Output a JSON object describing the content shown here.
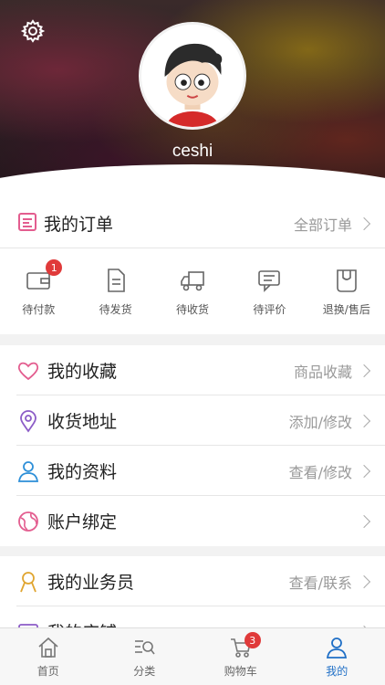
{
  "profile": {
    "username": "ceshi"
  },
  "orders": {
    "title": "我的订单",
    "all_label": "全部订单",
    "items": [
      {
        "label": "待付款",
        "badge": "1"
      },
      {
        "label": "待发货"
      },
      {
        "label": "待收货"
      },
      {
        "label": "待评价"
      },
      {
        "label": "退换/售后"
      }
    ]
  },
  "menu": [
    {
      "label": "我的收藏",
      "action": "商品收藏",
      "icon": "heart-icon",
      "color": "#e35d8f"
    },
    {
      "label": "收货地址",
      "action": "添加/修改",
      "icon": "location-pin-icon",
      "color": "#8c5cc7"
    },
    {
      "label": "我的资料",
      "action": "查看/修改",
      "icon": "user-icon",
      "color": "#2d8fd8"
    },
    {
      "label": "账户绑定",
      "action": "",
      "icon": "globe-icon",
      "color": "#e35d8f"
    }
  ],
  "menu2": [
    {
      "label": "我的业务员",
      "action": "查看/联系",
      "icon": "agent-icon",
      "color": "#e0a530"
    },
    {
      "label": "我的店铺",
      "action": "",
      "icon": "store-icon",
      "color": "#8c5cc7"
    }
  ],
  "tabbar": {
    "tabs": [
      {
        "label": "首页"
      },
      {
        "label": "分类"
      },
      {
        "label": "购物车",
        "badge": "3"
      },
      {
        "label": "我的"
      }
    ]
  },
  "colors": {
    "accent": "#1f6fc6",
    "badge": "#e03a3a",
    "order_icon": "#e35d8f"
  }
}
